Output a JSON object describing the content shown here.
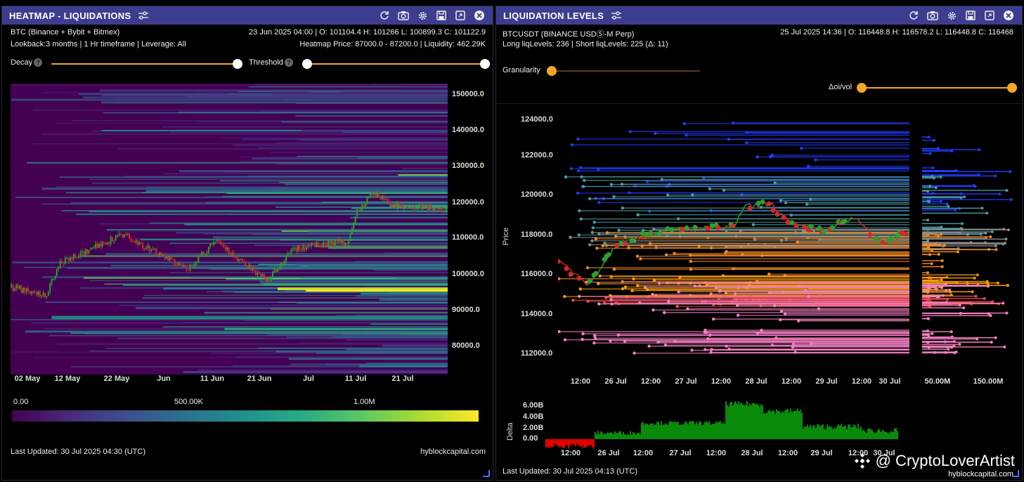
{
  "left": {
    "title": "HEATMAP - LIQUIDATIONS",
    "source": "BTC (Binance + Bybit + Bitmex)",
    "ohlc": "23 Jun 2025 04:00 | O: 101104.4 H: 101266 L: 100899.3 C: 101122.9",
    "lookback": "Lookback:3 months | 1 Hr timeframe | Leverage: All",
    "heatmap_price": "Heatmap Price: 87000.0 - 87200.0 | Liquidity: 462.29K",
    "decay_label": "Decay",
    "threshold_label": "Threshold",
    "help_glyph": "?",
    "decay_value": 1.0,
    "threshold_value": 0.0,
    "y_ticks": [
      "150000.0",
      "140000.0",
      "130000.0",
      "120000.0",
      "110000.0",
      "100000.0",
      "90000.0",
      "80000.0"
    ],
    "x_ticks": [
      "02 May",
      "12 May",
      "22 May",
      "Jun",
      "11 Jun",
      "21 Jun",
      "Jul",
      "11 Jul",
      "21 Jul"
    ],
    "colorbar_labels": [
      "0.00",
      "500.00K",
      "1.00M"
    ],
    "last_updated": "Last Updated: 30 Jul 2025 04:30 (UTC)",
    "site": "hyblockcapital.com",
    "colors": {
      "background": "#440154",
      "mid": "#21918c",
      "high": "#fde725"
    }
  },
  "right": {
    "title": "LIQUIDATION LEVELS",
    "symbol": "BTCUSDT (BINANCE USDⓈ-M Perp)",
    "ohlc": "25 Jul 2025 14:36 | O: 116448.8 H: 116578.2 L: 116448.8 C: 116468",
    "levels": "Long liqLevels: 236 | Short liqLevels: 225 (Δ: 11)",
    "granularity_label": "Granularity",
    "granularity_value": 0.0,
    "doi_label": "Δoi/vol",
    "doi_value": 1.0,
    "y_label": "Price",
    "y_ticks": [
      "124000.0",
      "122000.0",
      "120000.0",
      "118000.0",
      "116000.0",
      "114000.0",
      "112000.0"
    ],
    "x_ticks": [
      "12:00",
      "26 Jul",
      "12:00",
      "27 Jul",
      "12:00",
      "28 Jul",
      "12:00",
      "29 Jul",
      "12:00",
      "30 Jul"
    ],
    "side_x_ticks": [
      "50.00M",
      "150.00M"
    ],
    "delta_label": "Delta",
    "delta_ticks": [
      "6.00B",
      "4.00B",
      "2.00B",
      "0.00"
    ],
    "delta_x_ticks": [
      "12:00",
      "26 Jul",
      "12:00",
      "27 Jul",
      "12:00",
      "28 Jul",
      "12:00",
      "29 Jul",
      "12:00",
      "30 Jul"
    ],
    "last_updated": "Last Updated: 30 Jul 2025 04:13 (UTC)"
  },
  "watermark": {
    "handle": "@ CryptoLoverArtist",
    "site": "hyblockcapital.com"
  },
  "icons": [
    "filter-icon",
    "refresh-icon",
    "camera-icon",
    "gear-icon",
    "save-icon",
    "expand-icon",
    "close-icon"
  ]
}
